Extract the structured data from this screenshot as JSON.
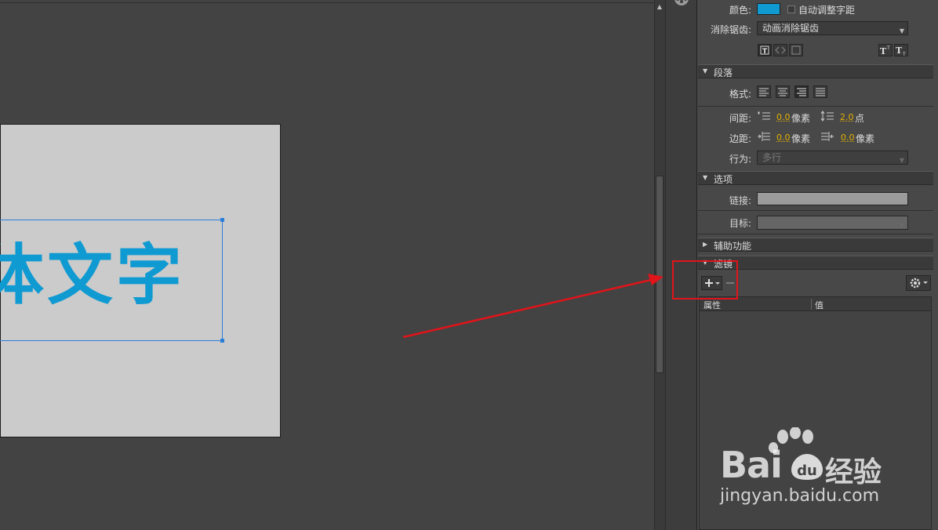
{
  "stage": {
    "text": "体文字"
  },
  "character": {
    "color_label": "颜色:",
    "color_value": "#0f9ad2",
    "auto_kern_label": "自动调整字距",
    "anti_alias_label": "消除锯齿:",
    "anti_alias_value": "动画消除锯齿"
  },
  "paragraph": {
    "header": "段落",
    "format_label": "格式:",
    "spacing_label": "间距:",
    "indent_value": "0.0",
    "indent_unit": "像素",
    "line_spacing_value": "2.0",
    "line_spacing_unit": "点",
    "margins_label": "边距:",
    "left_margin_value": "0.0",
    "left_margin_unit": "像素",
    "right_margin_value": "0.0",
    "right_margin_unit": "像素",
    "behavior_label": "行为:",
    "behavior_value": "多行"
  },
  "options": {
    "header": "选项",
    "link_label": "链接:",
    "link_value": "",
    "target_label": "目标:",
    "target_value": ""
  },
  "accessibility": {
    "header": "辅助功能"
  },
  "filters": {
    "header": "滤镜",
    "col_property": "属性",
    "col_value": "值"
  },
  "watermark": {
    "brand": "Bai",
    "du": "du",
    "suffix": "经验",
    "url": "jingyan.baidu.com"
  },
  "colors": {
    "annotation_red": "#e0141a",
    "text_blue": "#0f9ad2",
    "selection_blue": "#2b7fd8"
  }
}
